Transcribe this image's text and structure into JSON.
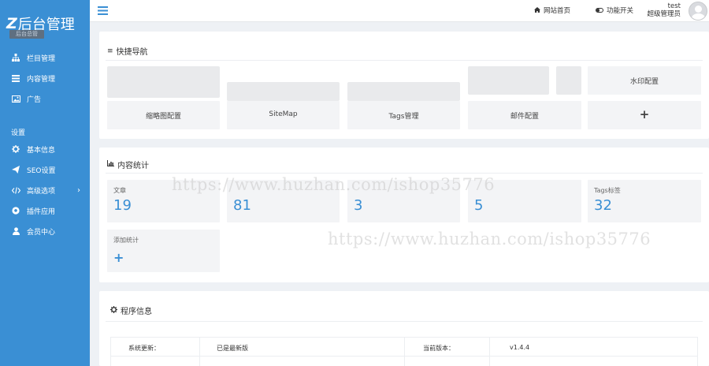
{
  "brand": {
    "logo_z": "Z",
    "logo_text": "后台管理",
    "badge": "后台总管"
  },
  "sidebar": {
    "items": [
      {
        "label": "栏目管理",
        "icon": "sitemap-icon"
      },
      {
        "label": "内容管理",
        "icon": "list-icon"
      },
      {
        "label": "广告",
        "icon": "image-icon"
      }
    ],
    "section_settings": "设置",
    "settings_items": [
      {
        "label": "基本信息",
        "icon": "gear-icon"
      },
      {
        "label": "SEO设置",
        "icon": "send-icon"
      },
      {
        "label": "高级选项",
        "icon": "code-icon",
        "arrow": "›"
      },
      {
        "label": "插件应用",
        "icon": "soccer-icon"
      },
      {
        "label": "会员中心",
        "icon": "user-icon"
      }
    ]
  },
  "topbar": {
    "home_label": "网站首页",
    "toggle_label": "功能开关",
    "user_name": "test",
    "user_role": "超级管理员"
  },
  "quick_nav": {
    "title": "快捷导航",
    "tiles_row2": [
      "缩略图配置",
      "SiteMap",
      "Tags管理",
      "邮件配置",
      "+"
    ],
    "watermark_tile": "水印配置"
  },
  "stats": {
    "title": "内容统计",
    "cards": [
      {
        "label": "文章",
        "value": "19"
      },
      {
        "label": "",
        "value": "81"
      },
      {
        "label": "",
        "value": "3"
      },
      {
        "label": "",
        "value": "5"
      },
      {
        "label": "Tags标签",
        "value": "32"
      }
    ],
    "add_label": "添加统计",
    "add_plus": "+"
  },
  "program": {
    "title": "程序信息",
    "update_label": "系统更新：",
    "update_value": "已是最新版",
    "version_label": "当前版本：",
    "version_value": "v1.4.4"
  },
  "watermarks": [
    "https://www.huzhan.com/ishop35776",
    "https://www.huzhan.com/ishop35776"
  ],
  "colors": {
    "sidebar": "#3a8fd4",
    "accent": "#3a8fd4",
    "background": "#eef1f5"
  }
}
